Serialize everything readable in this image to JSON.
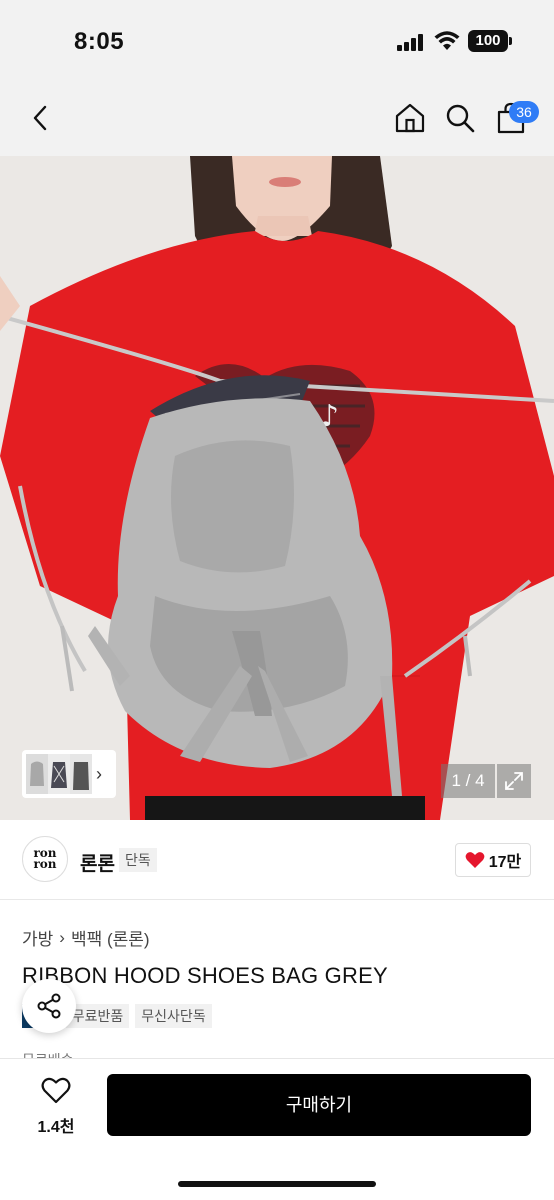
{
  "status": {
    "time": "8:05",
    "battery": "100"
  },
  "nav": {
    "cart_count": "36"
  },
  "gallery": {
    "counter": "1 / 4"
  },
  "brand": {
    "logo_line1": "ron",
    "logo_line2": "ron",
    "name": "론론",
    "tag": "단독",
    "likes": "17만"
  },
  "product": {
    "breadcrumb": [
      "가방",
      "백팩 (론론)"
    ],
    "title": "RIBBON HOOD SHOES BAG GREY",
    "tags": [
      "페이",
      "무료반품",
      "무신사단독"
    ],
    "peek_text": "무료배송"
  },
  "bottom": {
    "wish_count": "1.4천",
    "buy_label": "구매하기"
  },
  "colors": {
    "accent": "#2f7cf6",
    "buy_button": "#000000",
    "like_heart": "#e5162d",
    "pay_tag": "#0b3a63"
  }
}
